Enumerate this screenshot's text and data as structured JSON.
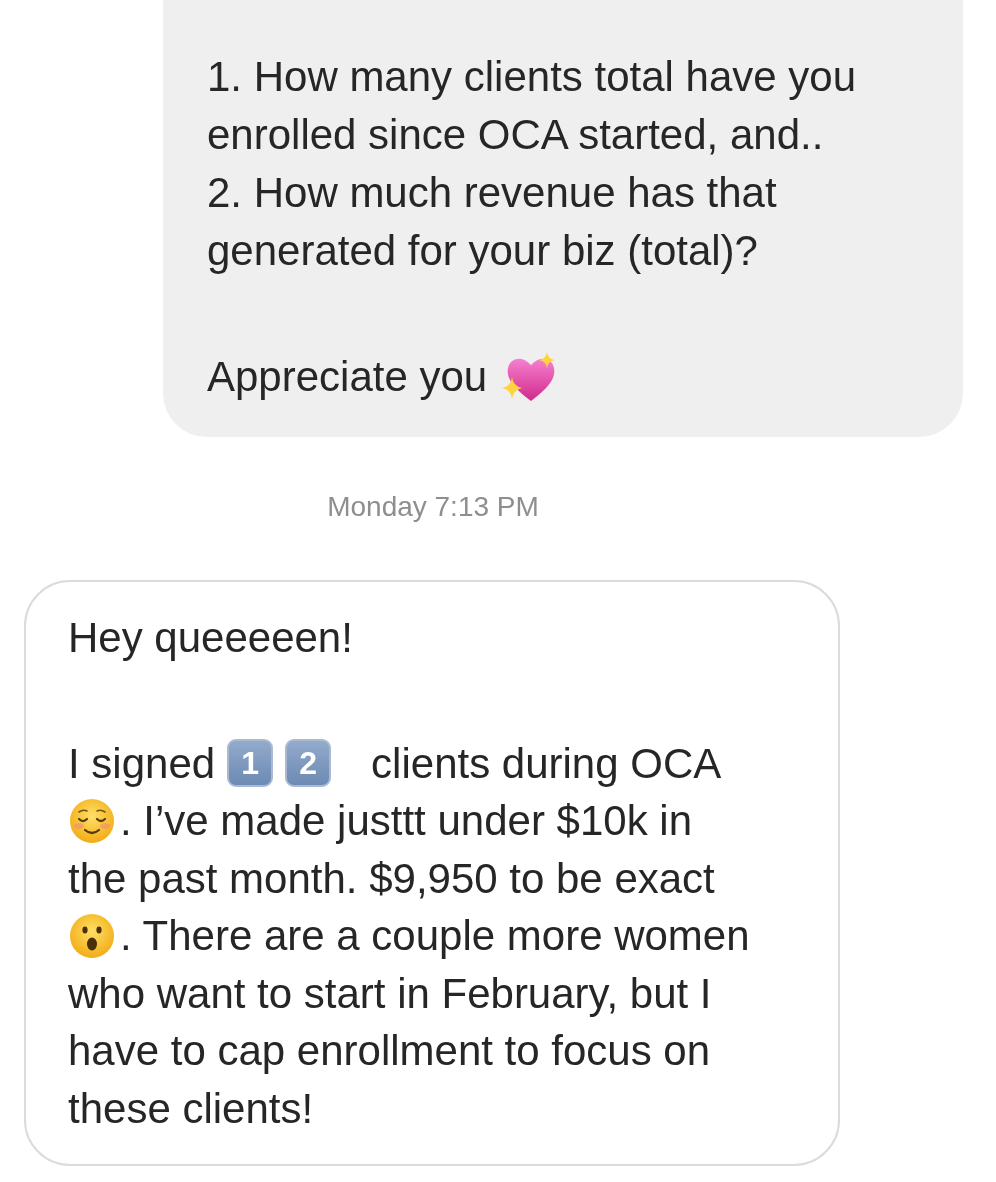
{
  "outgoing_message": {
    "items": [
      "1. How many clients total have you enrolled since OCA started, and..",
      "2. How much revenue has that generated for your biz (total)?"
    ],
    "closing": [
      {
        "kind": "text",
        "text": "Appreciate you"
      },
      {
        "kind": "heart"
      }
    ]
  },
  "timestamp": "Monday 7:13 PM",
  "incoming_message": {
    "greeting": "Hey queeeeen!",
    "lines": [
      {
        "parts": [
          {
            "kind": "text",
            "text": "I signed"
          },
          {
            "kind": "keycap",
            "text": "1"
          },
          {
            "kind": "keycap",
            "text": "2"
          },
          {
            "kind": "text",
            "text": "clients during OCA"
          }
        ]
      },
      {
        "parts": [
          {
            "kind": "smile"
          },
          {
            "kind": "text",
            "text": ". I’ve made justtt under $10k in"
          }
        ]
      },
      {
        "parts": [
          {
            "kind": "text",
            "text": "the past month. $9,950 to be exact"
          }
        ]
      },
      {
        "parts": [
          {
            "kind": "gasp"
          },
          {
            "kind": "text",
            "text": ". There are a couple more women"
          }
        ]
      },
      {
        "parts": [
          {
            "kind": "text",
            "text": "who want to start in February, but I"
          }
        ]
      },
      {
        "parts": [
          {
            "kind": "text",
            "text": "have to cap enrollment to focus on"
          }
        ]
      },
      {
        "parts": [
          {
            "kind": "text",
            "text": "these clients!"
          }
        ]
      }
    ]
  }
}
